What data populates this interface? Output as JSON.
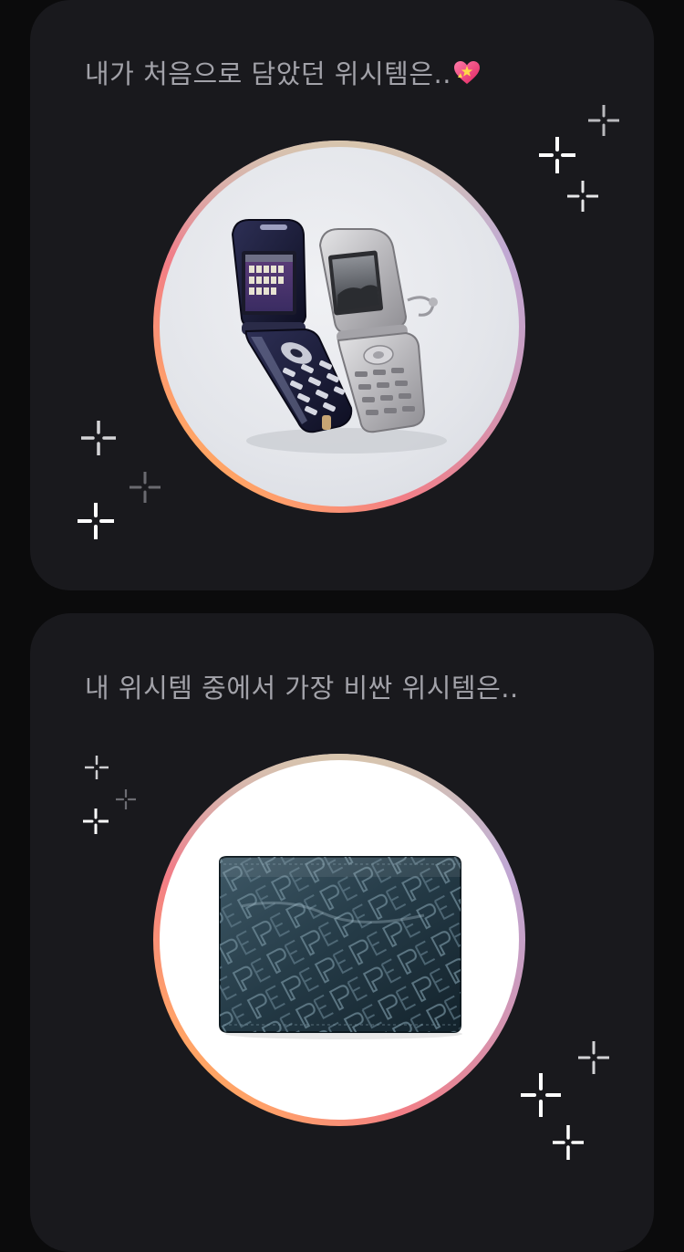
{
  "cards": [
    {
      "title": "내가 처음으로 담았던 위시템은..",
      "title_emoji": "sparkling-heart-icon",
      "image": "flip-phones-photo"
    },
    {
      "title": "내 위시템 중에서 가장 비싼 위시템은..",
      "image": "embossed-wallet-photo"
    }
  ],
  "colors": {
    "page_background": "#0b0b0c",
    "card_background": "#19191d",
    "title_text": "#a2a2a9",
    "ring_gradient": [
      "#ffc24a",
      "#f27e86",
      "#c99cc0",
      "#b4b9ee"
    ],
    "sparkle": "#ffffff"
  }
}
